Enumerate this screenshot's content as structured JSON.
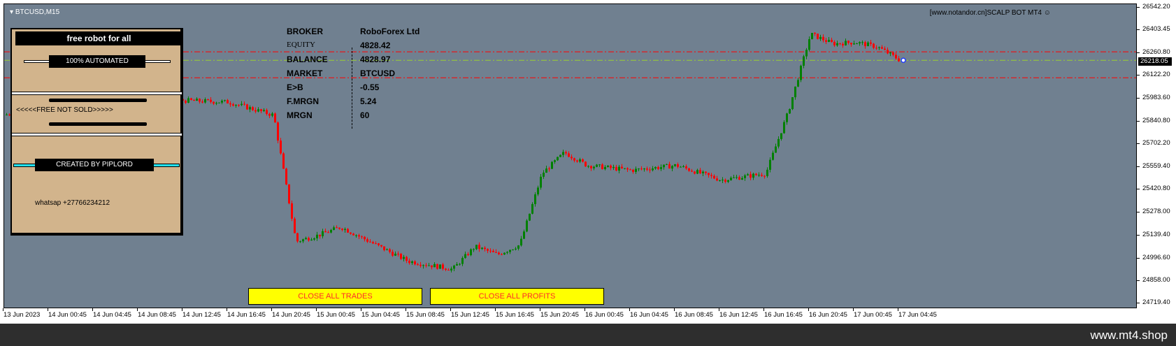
{
  "window": {
    "symbol": "BTCUSD,M15",
    "brand": "[www.notandor.cn]SCALP BOT MT4"
  },
  "price_axis": {
    "ticks": [
      "26542.20",
      "26403.45",
      "26260.80",
      "26122.20",
      "25983.60",
      "25840.80",
      "25702.20",
      "25559.40",
      "25420.80",
      "25278.00",
      "25139.40",
      "24996.60",
      "24858.00",
      "24719.40"
    ],
    "current_price": "26218.05"
  },
  "time_axis": {
    "ticks": [
      "13 Jun 2023",
      "14 Jun 00:45",
      "14 Jun 04:45",
      "14 Jun 08:45",
      "14 Jun 12:45",
      "14 Jun 16:45",
      "14 Jun 20:45",
      "15 Jun 00:45",
      "15 Jun 04:45",
      "15 Jun 08:45",
      "15 Jun 12:45",
      "15 Jun 16:45",
      "15 Jun 20:45",
      "16 Jun 00:45",
      "16 Jun 04:45",
      "16 Jun 08:45",
      "16 Jun 12:45",
      "16 Jun 16:45",
      "16 Jun 20:45",
      "17 Jun 00:45",
      "17 Jun 04:45"
    ]
  },
  "panel": {
    "title": "free robot for all",
    "automated": "100% AUTOMATED",
    "free_not_sold": "<<<<<FREE NOT SOLD>>>>>",
    "created_by": "CREATED BY PIPLORD",
    "whatsapp": "whatsap +27766234212"
  },
  "account": {
    "broker_label": "BROKER",
    "broker_value": "RoboForex Ltd",
    "equity_label": "EQUITY",
    "equity_value": "4828.42",
    "balance_label": "BALANCE",
    "balance_value": "4828.97",
    "market_label": "MARKET",
    "market_value": "BTCUSD",
    "eb_label": "E>B",
    "eb_value": "-0.55",
    "fmrgn_label": "F.MRGN",
    "fmrgn_value": "5.24",
    "mrgn_label": "MRGN",
    "mrgn_value": "60"
  },
  "buttons": {
    "close_trades": "CLOSE ALL TRADES",
    "close_profits": "CLOSE ALL PROFITS"
  },
  "colors": {
    "chart_bg": "#708090",
    "bull": "#008000",
    "bear": "#ff0000",
    "button_bg": "#ffff00",
    "button_text": "#ff2a2a",
    "cyan": "#22e0ee"
  },
  "footer": {
    "brand": "www.mt4.shop"
  },
  "chart_data": {
    "type": "candlestick",
    "title": "",
    "y_range": [
      24719.4,
      26542.2
    ],
    "horizontal_levels": [
      {
        "price": 26270,
        "color": "#ff0000",
        "style": "dashdot"
      },
      {
        "price": 26218,
        "color": "#9acd32",
        "style": "dashdot"
      },
      {
        "price": 26110,
        "color": "#ff0000",
        "style": "dashdot"
      }
    ],
    "price_path": [
      {
        "time": "13 Jun 2023",
        "price": 25880
      },
      {
        "time": "14 Jun 00:45",
        "price": 25990
      },
      {
        "time": "14 Jun 04:45",
        "price": 25960
      },
      {
        "time": "14 Jun 08:45",
        "price": 25990
      },
      {
        "time": "14 Jun 12:45",
        "price": 25970
      },
      {
        "time": "14 Jun 16:45",
        "price": 25960
      },
      {
        "time": "14 Jun 20:45",
        "price": 25880
      },
      {
        "time": "14 Jun 22:45",
        "price": 25100
      },
      {
        "time": "15 Jun 00:45",
        "price": 25140
      },
      {
        "time": "15 Jun 02:45",
        "price": 25190
      },
      {
        "time": "15 Jun 04:45",
        "price": 25120
      },
      {
        "time": "15 Jun 08:45",
        "price": 24980
      },
      {
        "time": "15 Jun 12:45",
        "price": 24930
      },
      {
        "time": "15 Jun 14:45",
        "price": 25070
      },
      {
        "time": "15 Jun 16:45",
        "price": 25020
      },
      {
        "time": "15 Jun 18:45",
        "price": 25080
      },
      {
        "time": "15 Jun 20:45",
        "price": 25520
      },
      {
        "time": "15 Jun 22:45",
        "price": 25650
      },
      {
        "time": "16 Jun 00:45",
        "price": 25570
      },
      {
        "time": "16 Jun 04:45",
        "price": 25540
      },
      {
        "time": "16 Jun 08:45",
        "price": 25570
      },
      {
        "time": "16 Jun 12:45",
        "price": 25480
      },
      {
        "time": "16 Jun 16:45",
        "price": 25520
      },
      {
        "time": "16 Jun 18:45",
        "price": 25900
      },
      {
        "time": "16 Jun 20:45",
        "price": 26380
      },
      {
        "time": "16 Jun 22:45",
        "price": 26320
      },
      {
        "time": "17 Jun 00:45",
        "price": 26330
      },
      {
        "time": "17 Jun 02:45",
        "price": 26300
      },
      {
        "time": "17 Jun 04:45",
        "price": 26218
      }
    ]
  }
}
